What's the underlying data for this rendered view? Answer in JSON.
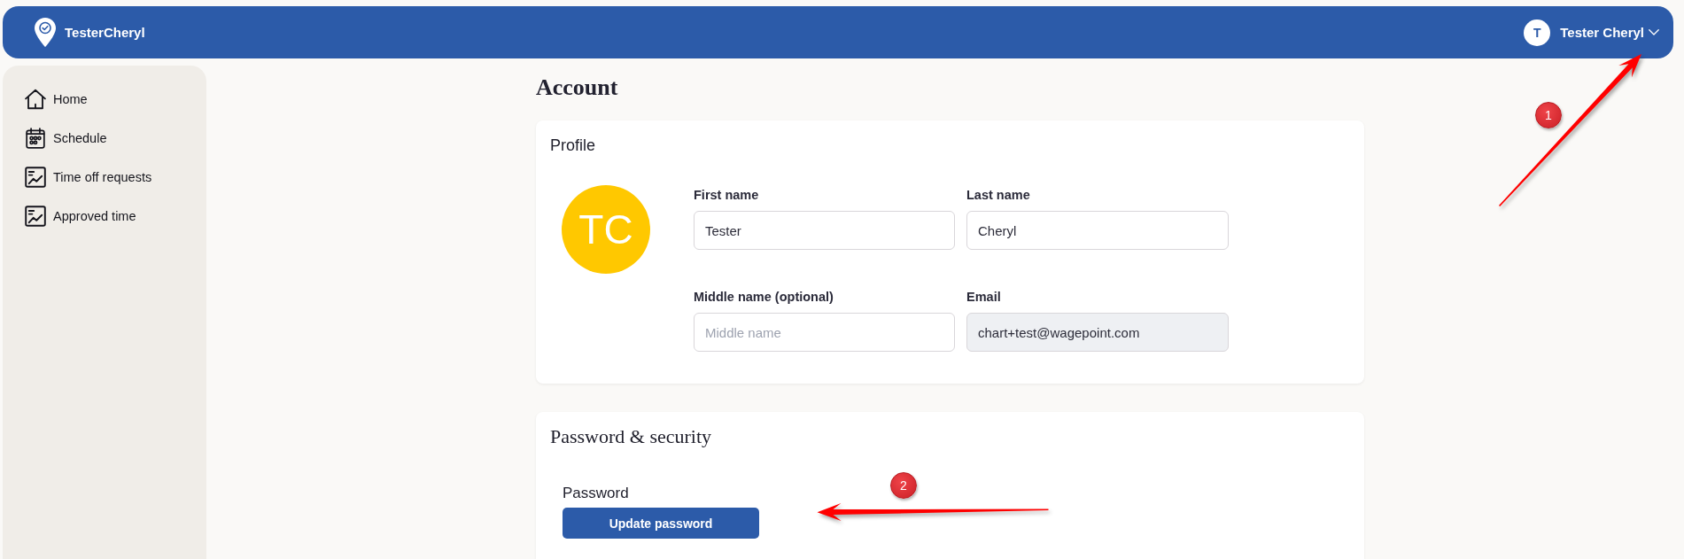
{
  "top_bar": {
    "app_name": "TesterCheryl",
    "user": {
      "initial": "T",
      "name": "Tester Cheryl"
    }
  },
  "sidebar": {
    "items": [
      {
        "kind": "home",
        "label": "Home",
        "selected": false
      },
      {
        "kind": "calendar",
        "label": "Schedule",
        "selected": false
      },
      {
        "kind": "chart",
        "label": "Time off requests",
        "selected": false
      },
      {
        "kind": "chart",
        "label": "Approved time",
        "selected": false
      }
    ]
  },
  "page": {
    "title": "Account"
  },
  "profile": {
    "title": "Profile",
    "avatar_initials": "TC",
    "fields": [
      {
        "label": "First name",
        "value": "Tester",
        "disabled": false
      },
      {
        "label": "Last name",
        "value": "Cheryl",
        "disabled": false
      },
      {
        "label": "Middle name (optional)",
        "placeholder": "Middle name",
        "disabled": false
      },
      {
        "label": "Email",
        "value": "chart+test@wagepoint.com",
        "disabled": true
      }
    ]
  },
  "security": {
    "title": "Password & security",
    "password_label": "Password",
    "button": "Update password"
  },
  "annotations": [
    {
      "number": "1"
    },
    {
      "number": "2"
    }
  ]
}
